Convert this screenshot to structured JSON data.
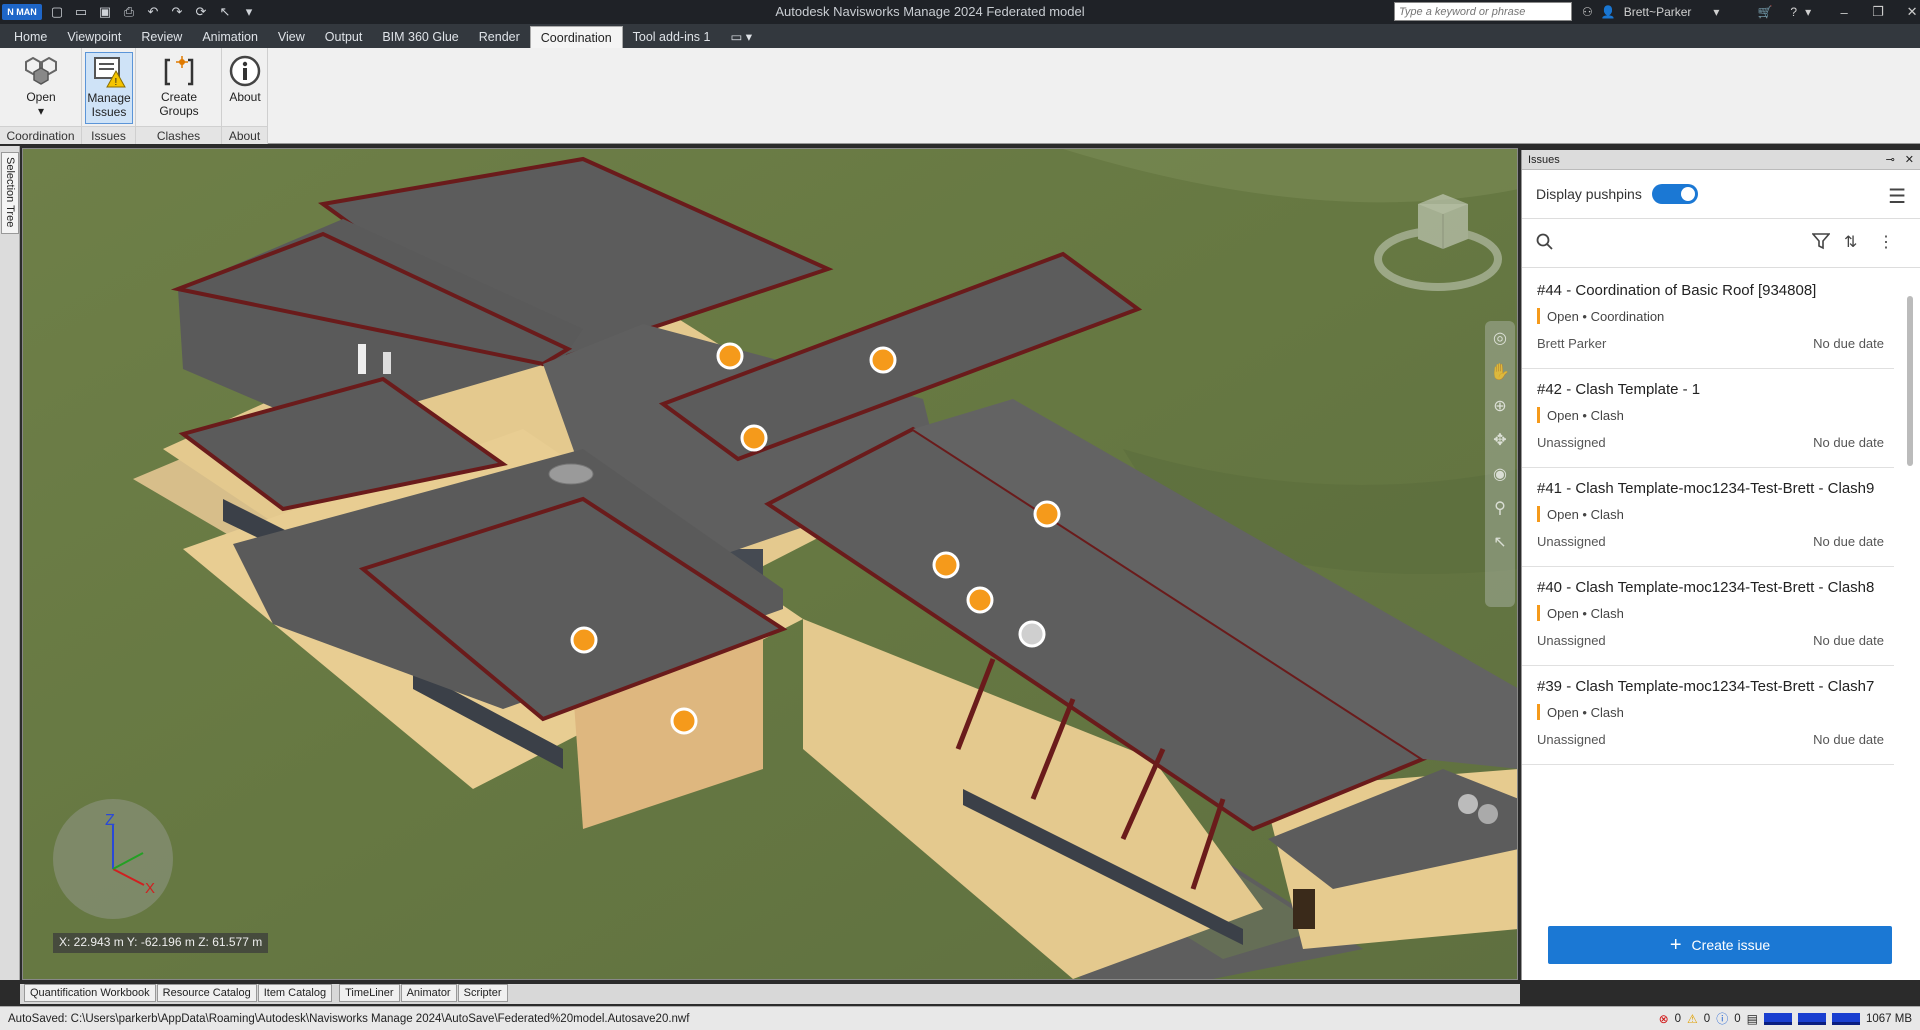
{
  "titlebar": {
    "app_badge": "N MAN",
    "title": "Autodesk Navisworks Manage 2024     Federated model",
    "search_placeholder": "Type a keyword or phrase",
    "user": "Brett~Parker"
  },
  "ribbon": {
    "tabs": [
      "Home",
      "Viewpoint",
      "Review",
      "Animation",
      "View",
      "Output",
      "BIM 360 Glue",
      "Render",
      "Coordination",
      "Tool add-ins 1"
    ],
    "active_tab": "Coordination",
    "groups": {
      "coordination": {
        "label": "Coordination",
        "open_label": "Open"
      },
      "issues": {
        "label": "Issues",
        "manage_line1": "Manage",
        "manage_line2": "Issues"
      },
      "clashes": {
        "label": "Clashes",
        "create_groups_label": "Create Groups"
      },
      "about": {
        "label": "About",
        "about_label": "About"
      }
    }
  },
  "left_dock": {
    "selection_tree": "Selection Tree"
  },
  "viewport": {
    "coords": "X: 22.943 m  Y: -62.196 m  Z: 61.577 m",
    "axis": {
      "z": "Z",
      "x": "X"
    }
  },
  "bottom_tabs": [
    "Quantification Workbook",
    "Resource Catalog",
    "Item Catalog",
    "TimeLiner",
    "Animator",
    "Scripter"
  ],
  "status": {
    "text": "AutoSaved: C:\\Users\\parkerb\\AppData\\Roaming\\Autodesk\\Navisworks Manage 2024\\AutoSave\\Federated%20model.Autosave20.nwf",
    "errors": "0",
    "warnings": "0",
    "info": "0",
    "memory": "1067 MB"
  },
  "issues_panel": {
    "header": "Issues",
    "display_pushpins": "Display pushpins",
    "create_issue": "Create issue",
    "issues": [
      {
        "title": "#44 - Coordination of Basic Roof [934808]",
        "status": "Open • Coordination",
        "assignee": "Brett Parker",
        "due": "No due date"
      },
      {
        "title": "#42 - Clash Template - 1",
        "status": "Open • Clash",
        "assignee": "Unassigned",
        "due": "No due date"
      },
      {
        "title": "#41 - Clash Template-moc1234-Test-Brett - Clash9",
        "status": "Open • Clash",
        "assignee": "Unassigned",
        "due": "No due date"
      },
      {
        "title": "#40 - Clash Template-moc1234-Test-Brett - Clash8",
        "status": "Open • Clash",
        "assignee": "Unassigned",
        "due": "No due date"
      },
      {
        "title": "#39 - Clash Template-moc1234-Test-Brett - Clash7",
        "status": "Open • Clash",
        "assignee": "Unassigned",
        "due": "No due date"
      }
    ]
  },
  "colors": {
    "accent": "#1b78d4",
    "pushpin": "#f59a1b",
    "status_open": "#f59a1b"
  }
}
